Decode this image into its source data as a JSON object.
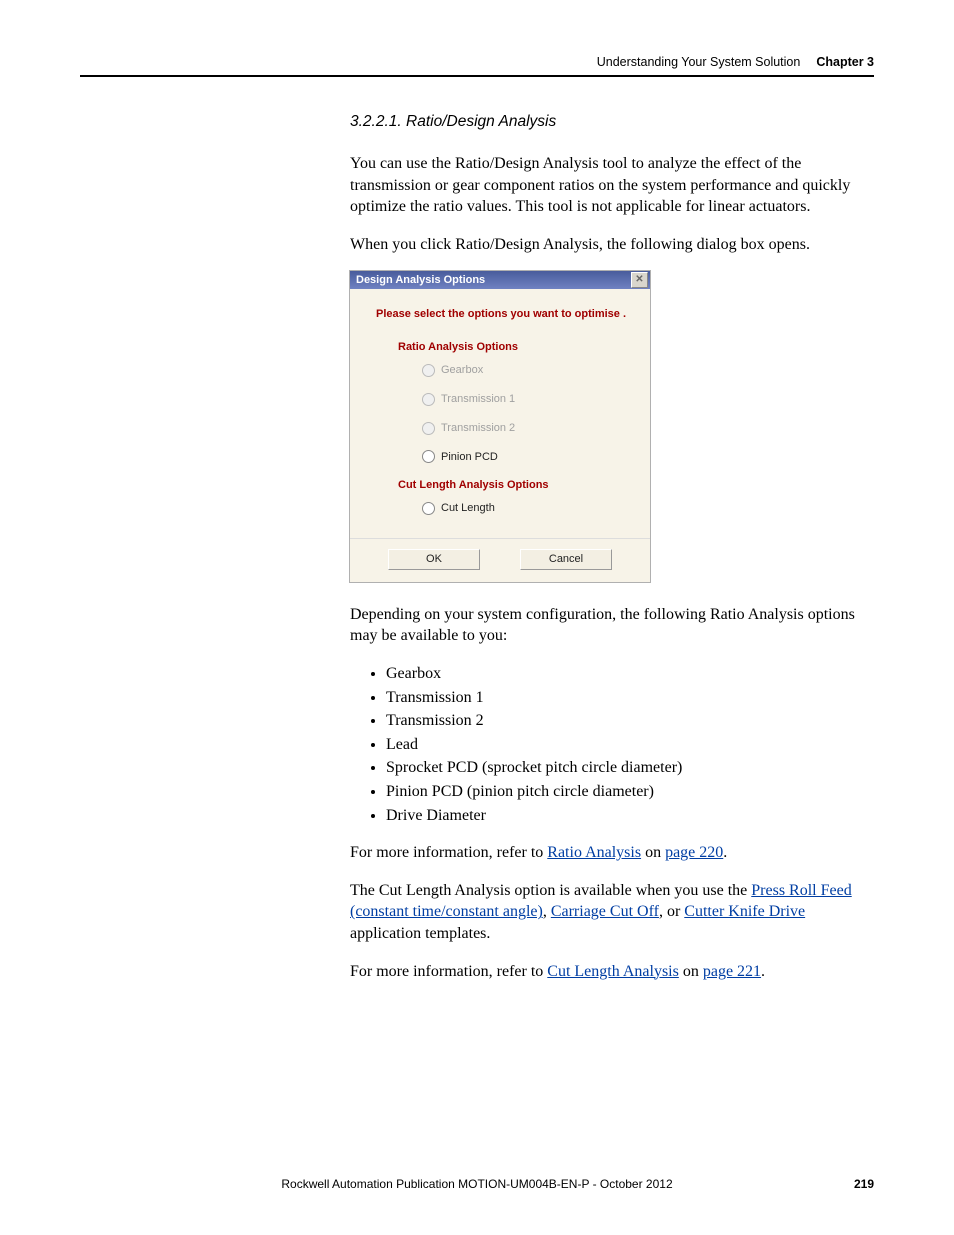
{
  "header": {
    "section": "Understanding Your System Solution",
    "chapter": "Chapter 3"
  },
  "section_heading": "3.2.2.1.    Ratio/Design Analysis",
  "p1": "You can use the Ratio/Design Analysis tool to analyze the effect of the transmission or gear component ratios on the system performance and quickly optimize the ratio values. This tool is not applicable for linear actuators.",
  "p2": "When you click Ratio/Design Analysis, the following dialog box opens.",
  "dialog": {
    "title": "Design Analysis Options",
    "instruction": "Please select the options you want to optimise .",
    "groups": [
      {
        "title": "Ratio Analysis Options",
        "options": [
          {
            "label": "Gearbox",
            "enabled": false
          },
          {
            "label": "Transmission 1",
            "enabled": false
          },
          {
            "label": "Transmission 2",
            "enabled": false
          },
          {
            "label": "Pinion PCD",
            "enabled": true
          }
        ]
      },
      {
        "title": "Cut Length Analysis Options",
        "options": [
          {
            "label": "Cut Length",
            "enabled": true
          }
        ]
      }
    ],
    "buttons": {
      "ok": "OK",
      "cancel": "Cancel"
    }
  },
  "p3": "Depending on your system configuration, the following Ratio Analysis options may be available to you:",
  "ratio_options": [
    "Gearbox",
    "Transmission 1",
    "Transmission 2",
    "Lead",
    "Sprocket PCD (sprocket pitch circle diameter)",
    "Pinion PCD (pinion pitch circle diameter)",
    "Drive Diameter"
  ],
  "p4": {
    "pre": "For more information, refer to ",
    "link1": "Ratio Analysis",
    "mid": " on ",
    "link2": "page 220",
    "post": "."
  },
  "p5": {
    "pre": "The Cut Length Analysis option is available when you use the ",
    "link1": "Press Roll Feed (constant time/constant angle)",
    "sep1": ", ",
    "link2": "Carriage Cut Off",
    "sep2": ", or ",
    "link3": "Cutter Knife Drive",
    "post": " application templates."
  },
  "p6": {
    "pre": "For more information, refer to ",
    "link1": "Cut Length Analysis",
    "mid": " on ",
    "link2": "page 221",
    "post": "."
  },
  "footer": {
    "pub": "Rockwell Automation Publication MOTION-UM004B-EN-P - October 2012",
    "page": "219"
  }
}
